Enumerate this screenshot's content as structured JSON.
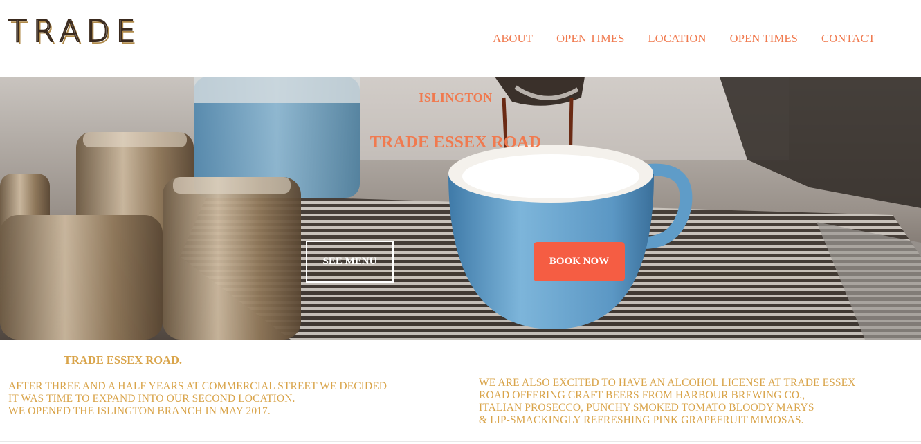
{
  "header": {
    "logo": "TRADE",
    "nav": [
      "ABOUT",
      "OPEN TIMES",
      "LOCATION",
      "OPEN TIMES",
      "CONTACT"
    ]
  },
  "hero": {
    "subtitle": "ISLINGTON",
    "title": "TRADE ESSEX ROAD",
    "see_menu_label": "SEE MENU",
    "book_now_label": "BOOK NOW"
  },
  "content": {
    "title": "TRADE ESSEX ROAD.",
    "left_lines": [
      "AFTER THREE AND A HALF YEARS AT COMMERCIAL STREET WE DECIDED",
      "IT WAS TIME TO EXPAND INTO OUR SECOND LOCATION.",
      "WE OPENED THE ISLINGTON BRANCH IN MAY 2017."
    ],
    "right_lines": [
      "WE ARE ALSO EXCITED TO HAVE AN ALCOHOL LICENSE AT TRADE ESSEX",
      "ROAD OFFERING CRAFT BEERS FROM HARBOUR BREWING CO.,",
      "ITALIAN PROSECCO, PUNCHY SMOKED TOMATO BLOODY MARYS",
      "& LIP-SMACKINGLY REFRESHING PINK GRAPEFRUIT MIMOSAS."
    ]
  },
  "colors": {
    "accent": "#f07a4f",
    "button": "#f55d43",
    "text_gold": "#d9a44a",
    "cup_blue": "#6aa6cf"
  }
}
